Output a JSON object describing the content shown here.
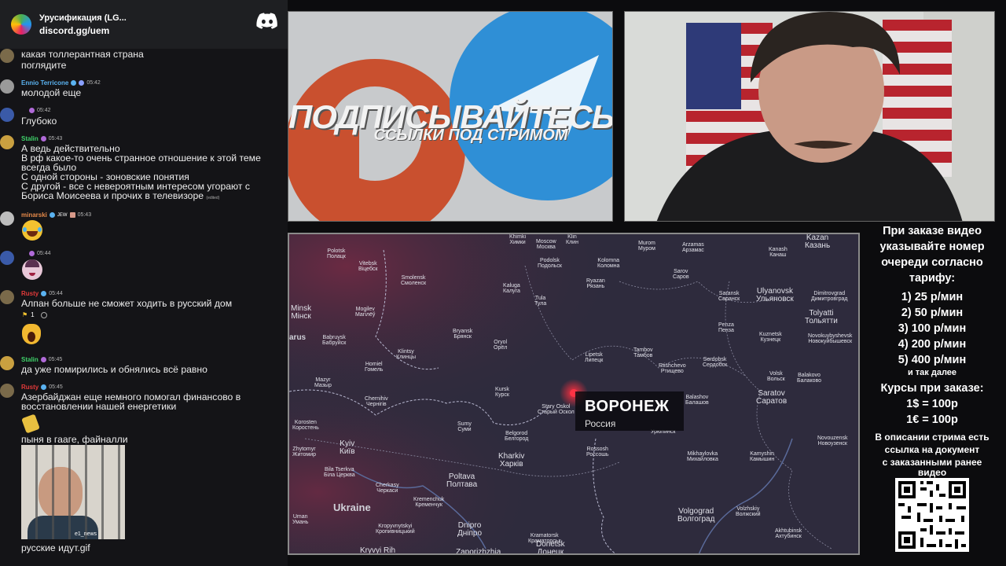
{
  "server": {
    "name": "Урусификация (LG...",
    "invite": "discord.gg/uem",
    "logo_icon": "discord-logo-icon"
  },
  "chat": {
    "messages": [
      {
        "author": "",
        "time": "",
        "lines": [
          "какая толлерантная страна",
          "поглядите"
        ]
      },
      {
        "author": "Ennio Terricone",
        "time": "05:42",
        "color": "#5ab2f0",
        "lines": [
          "молодой еще"
        ]
      },
      {
        "author": "",
        "time": "05:42",
        "lines": [
          "Глубоко"
        ]
      },
      {
        "author": "Stalin",
        "time": "05:43",
        "color": "#3fd16a",
        "lines": [
          "А ведь действительно",
          "В рф какое-то очень странное отношение к этой теме",
          "всегда было",
          "С одной стороны - зоновские понятия",
          "С другой - все с невероятным интересом угорают с",
          "Бориса Моисеева и прочих в телевизоре"
        ],
        "edited": "(edited)"
      },
      {
        "author": "minarski",
        "time": "05:43",
        "color": "#e68a4a",
        "badge_text": "JEW",
        "lines": []
      },
      {
        "author": "",
        "time": "05:44",
        "lines": []
      },
      {
        "author": "Rusty",
        "time": "05:44",
        "color": "#e23a3a",
        "lines": [
          "Алпан больше не сможет ходить в русский дом"
        ],
        "reaction_count": "1"
      },
      {
        "author": "Stalin",
        "time": "05:45",
        "color": "#3fd16a",
        "lines": [
          "да уже помирились и обнялись всё равно"
        ]
      },
      {
        "author": "Rusty",
        "time": "05:45",
        "color": "#e23a3a",
        "lines": [
          "Азербайджан еще немного помогал финансово в",
          "восстановлении нашей енергетики"
        ]
      },
      {
        "author": "",
        "time": "",
        "lines": [
          "пыня в гааге, файналли"
        ]
      },
      {
        "author": "",
        "time": "",
        "lines": [
          "русские идут.gif"
        ],
        "gif_watermark": "e1_news"
      }
    ]
  },
  "promo": {
    "title": "ПОДПИСЫВАЙТЕСЬ",
    "subtitle": "ССЫЛКИ ПОД СТРИМОМ",
    "left_logo_color": "#c9502f",
    "right_logo_color": "#2f8fd6"
  },
  "map": {
    "highlight": {
      "name": "ВОРОНЕЖ",
      "country": "Россия"
    },
    "countries": [
      "Ukraine",
      "arus"
    ],
    "cities": [
      {
        "en": "Moscow",
        "ru": "Москва"
      },
      {
        "en": "Khimki",
        "ru": "Химки"
      },
      {
        "en": "Klin",
        "ru": "Клин"
      },
      {
        "en": "Podolsk",
        "ru": "Подольск"
      },
      {
        "en": "Kolomna",
        "ru": "Коломна"
      },
      {
        "en": "Vitebsk",
        "ru": "Віцебск"
      },
      {
        "en": "Polotsk",
        "ru": "Полацк"
      },
      {
        "en": "Smolensk",
        "ru": "Смоленск"
      },
      {
        "en": "Minsk",
        "ru": "Мінск"
      },
      {
        "en": "Mogilev",
        "ru": "Магілёў"
      },
      {
        "en": "Babruysk",
        "ru": "Бабруйск"
      },
      {
        "en": "Kaluga",
        "ru": "Калуга"
      },
      {
        "en": "Tula",
        "ru": "Тула"
      },
      {
        "en": "Ryazan",
        "ru": "Рязань"
      },
      {
        "en": "Bryansk",
        "ru": "Брянск"
      },
      {
        "en": "Oryol",
        "ru": "Орёл"
      },
      {
        "en": "Klintsy",
        "ru": "Клинцы"
      },
      {
        "en": "Lipetsk",
        "ru": "Липецк"
      },
      {
        "en": "Tambov",
        "ru": "Тамбов"
      },
      {
        "en": "Homiel",
        "ru": "Гомель"
      },
      {
        "en": "Mazyr",
        "ru": "Мазыр"
      },
      {
        "en": "Chernihiv",
        "ru": "Чернігів"
      },
      {
        "en": "Kursk",
        "ru": "Курск"
      },
      {
        "en": "Stary Oskol",
        "ru": "Старый Оскол"
      },
      {
        "en": "Sumy",
        "ru": "Суми"
      },
      {
        "en": "Belgorod",
        "ru": "Белгород"
      },
      {
        "en": "Korosten",
        "ru": "Коростень"
      },
      {
        "en": "Kyiv",
        "ru": "Київ"
      },
      {
        "en": "Zhytomyr",
        "ru": "Житомир"
      },
      {
        "en": "Bila Tserkva",
        "ru": "Біла Церква"
      },
      {
        "en": "Kharkiv",
        "ru": "Харків"
      },
      {
        "en": "Poltava",
        "ru": "Полтава"
      },
      {
        "en": "Cherkasy",
        "ru": "Черкаси"
      },
      {
        "en": "Kremenchuk",
        "ru": "Кременчук"
      },
      {
        "en": "Uman",
        "ru": "Умань"
      },
      {
        "en": "Kropyvnytskyi",
        "ru": "Кропивницький"
      },
      {
        "en": "Dnipro",
        "ru": "Дніпро"
      },
      {
        "en": "Kryvyi Rih",
        "ru": ""
      },
      {
        "en": "Kramatorsk",
        "ru": "Краматорськ"
      },
      {
        "en": "Donetsk",
        "ru": "Донецк"
      },
      {
        "en": "Zaporizhzhia",
        "ru": ""
      },
      {
        "en": "Rossosh",
        "ru": "Россошь"
      },
      {
        "en": "Uryupinsk",
        "ru": "Урюпинск"
      },
      {
        "en": "Rtishchevo",
        "ru": "Ртищево"
      },
      {
        "en": "Serdobsk",
        "ru": "Сердобск"
      },
      {
        "en": "Balashov",
        "ru": "Балашов"
      },
      {
        "en": "Saratov",
        "ru": "Саратов"
      },
      {
        "en": "Volsk",
        "ru": "Вольск"
      },
      {
        "en": "Balakovo",
        "ru": "Балаково"
      },
      {
        "en": "Kamyshin",
        "ru": "Камышин"
      },
      {
        "en": "Mikhaylovka",
        "ru": "Михайловка"
      },
      {
        "en": "Volgograd",
        "ru": "Волгоград"
      },
      {
        "en": "Volzhskiy",
        "ru": "Волжский"
      },
      {
        "en": "Akhtubinsk",
        "ru": "Ахтубинск"
      },
      {
        "en": "Novouzensk",
        "ru": "Новоузенск"
      },
      {
        "en": "Tolyatti",
        "ru": "Тольятти"
      },
      {
        "en": "Ulyanovsk",
        "ru": "Ульяновск"
      },
      {
        "en": "Kuznetsk",
        "ru": "Кузнецк"
      },
      {
        "en": "Kazan",
        "ru": "Казань"
      },
      {
        "en": "Saransk",
        "ru": "Саранск"
      },
      {
        "en": "Penza",
        "ru": "Пенза"
      },
      {
        "en": "Sarov",
        "ru": "Саров"
      },
      {
        "en": "Arzamas",
        "ru": "Арзамас"
      },
      {
        "en": "Murom",
        "ru": "Муром"
      },
      {
        "en": "Kanash",
        "ru": "Канаш"
      },
      {
        "en": "Dimitrovgrad",
        "ru": "Димитровград"
      },
      {
        "en": "Novokuybyshevsk",
        "ru": "Новокуйбышевск"
      }
    ]
  },
  "order": {
    "intro": [
      "При заказе видео",
      "указывайте номер",
      "очереди согласно",
      "тарифу:"
    ],
    "tariffs": [
      "1) 25 р/мин",
      "2) 50 р/мин",
      "3) 100 р/мин",
      "4) 200 р/мин",
      "5) 400 р/мин"
    ],
    "and_so_on": "и так далее",
    "rates_title": "Курсы при заказе:",
    "rates": [
      "1$ = 100р",
      "1€ = 100р"
    ],
    "description": [
      "В описании стрима есть",
      "ссылка на документ",
      "с заказанными ранее",
      "видео"
    ],
    "qr_icon": "qr-code-icon"
  }
}
